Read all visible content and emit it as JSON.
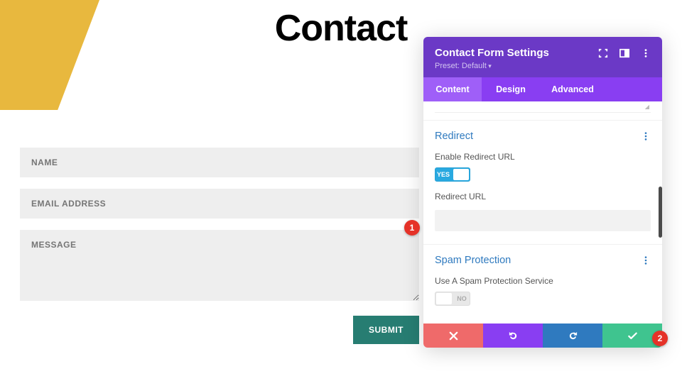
{
  "page": {
    "title": "Contact"
  },
  "form": {
    "name_placeholder": "NAME",
    "email_placeholder": "EMAIL ADDRESS",
    "message_placeholder": "MESSAGE",
    "submit_label": "SUBMIT"
  },
  "panel": {
    "title": "Contact Form Settings",
    "preset": "Preset: Default",
    "tabs": {
      "content": "Content",
      "design": "Design",
      "advanced": "Advanced"
    },
    "redirect": {
      "section_title": "Redirect",
      "enable_label": "Enable Redirect URL",
      "enable_value": "YES",
      "url_label": "Redirect URL",
      "url_value": ""
    },
    "spam": {
      "section_title": "Spam Protection",
      "service_label": "Use A Spam Protection Service",
      "service_value": "NO"
    }
  },
  "callouts": {
    "one": "1",
    "two": "2"
  }
}
